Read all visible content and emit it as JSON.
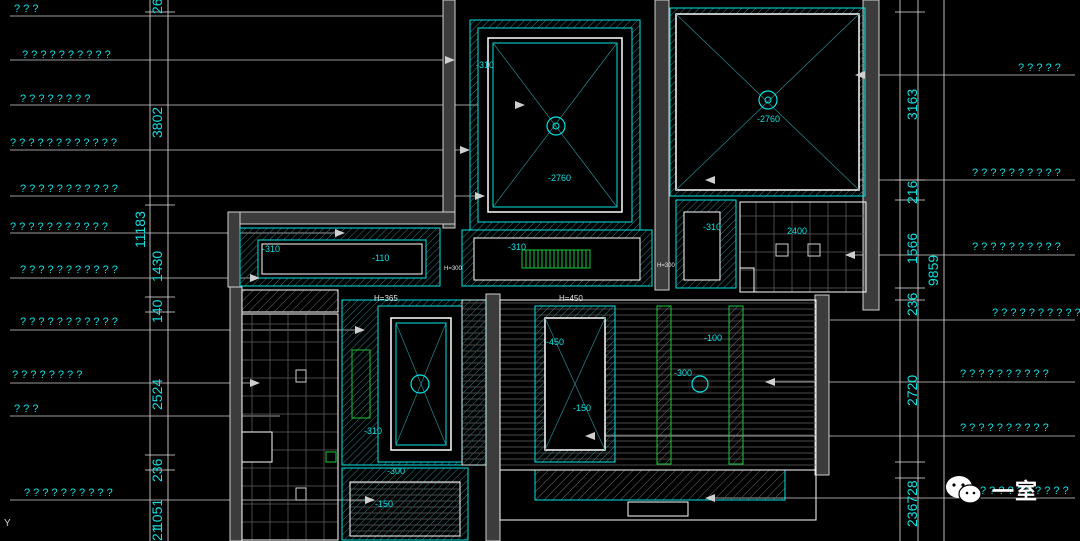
{
  "colors": {
    "background": "#000000",
    "wall": "#3a3a3a",
    "wall_edge": "#cfcfcf",
    "cyan": "#00e5e5",
    "green": "#19c93a",
    "white": "#e6e6e6",
    "text": "#14e0e0"
  },
  "left_callouts": [
    "? ? ?",
    "? ? ? ? ? ? ? ? ? ?",
    "? ? ? ? ? ? ? ?",
    "? ? ? ? ? ? ? ? ? ? ? ?",
    "? ? ? ? ? ? ? ? ? ? ?",
    "? ? ? ? ? ? ? ? ? ? ?",
    "? ? ? ? ? ? ? ? ? ? ?",
    "? ? ? ? ? ? ? ? ? ? ?",
    "? ? ? ? ? ? ? ?",
    "? ? ?",
    "? ? ? ? ? ? ? ? ? ?"
  ],
  "right_callouts": [
    "? ? ? ? ?",
    "? ? ? ? ? ? ? ? ? ?",
    "? ? ? ? ? ? ? ? ? ?",
    "? ? ? ? ? ? ? ? ? ?",
    "? ? ? ? ? ? ? ? ? ?",
    "? ? ? ? ? ? ? ? ? ?",
    "? ? ? ? ? ? ? ? ? ?"
  ],
  "left_dims": {
    "top": "26",
    "d3802": "3802",
    "d11183": "11183",
    "d1430": "1430",
    "d140": "140",
    "d2524": "2524",
    "d236": "236",
    "d1051": "1051",
    "d21": "21"
  },
  "right_dims": {
    "d3163": "3163",
    "d216": "216",
    "d1566": "1566",
    "d9859": "9859",
    "d236": "236",
    "d2720": "2720",
    "d236b": "236728"
  },
  "levels": {
    "r310_top": "-310",
    "r2760_a": "-2760",
    "r2760_b": "-2760",
    "r310_left": "-310",
    "r110": "-110",
    "r310_mid": "-310",
    "r310_small": "-310",
    "r2400": "2400",
    "r450": "-450",
    "r100": "-100",
    "r300": "-300",
    "r150": "-150",
    "r310_bath": "-310",
    "r300_bath": "-300",
    "r150_bath": "-150"
  },
  "heights": {
    "h365": "H=365",
    "h450": "H=450",
    "h300a": "H=300",
    "h300b": "H=300"
  },
  "axis_label": "Y",
  "watermark": "一室"
}
